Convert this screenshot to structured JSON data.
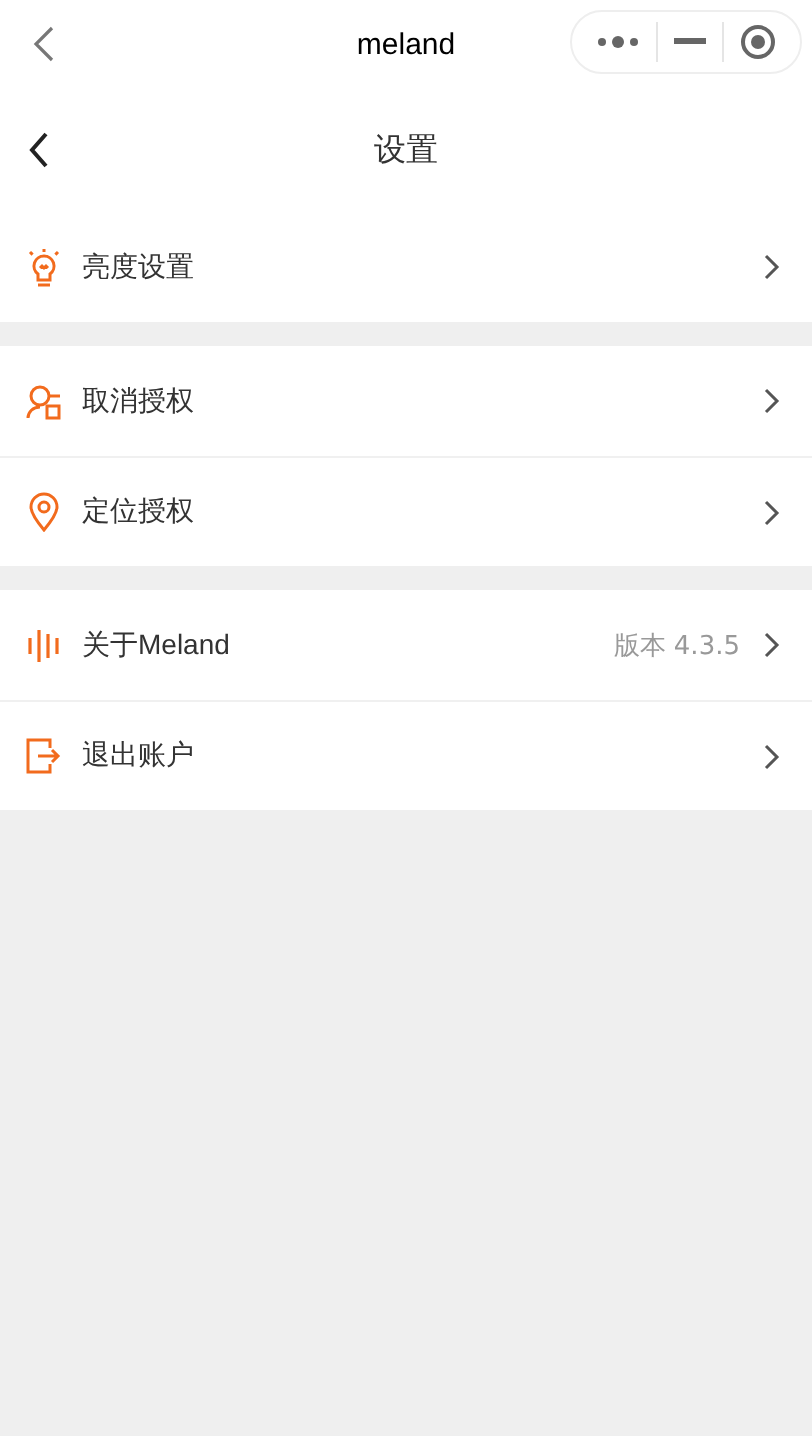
{
  "top_bar": {
    "title": "meland"
  },
  "header": {
    "title": "设置"
  },
  "groups": [
    {
      "items": [
        {
          "kind": "bulb",
          "label": "亮度设置"
        }
      ]
    },
    {
      "items": [
        {
          "kind": "user",
          "label": "取消授权"
        },
        {
          "kind": "pin",
          "label": "定位授权"
        }
      ]
    },
    {
      "items": [
        {
          "kind": "bars",
          "label": "关于Meland",
          "value": "版本 4.3.5"
        },
        {
          "kind": "exit",
          "label": "退出账户"
        }
      ]
    }
  ]
}
